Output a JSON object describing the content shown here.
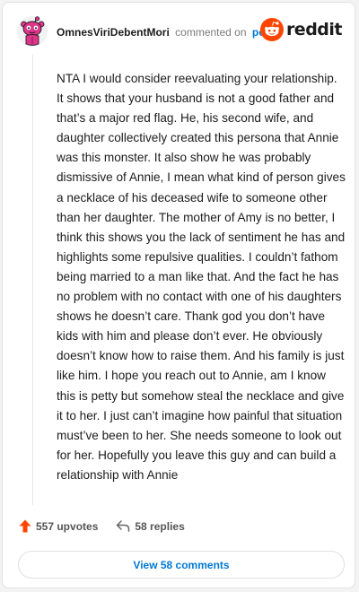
{
  "header": {
    "username": "OmnesViriDebentMori",
    "action_text": "commented on",
    "post_link": "post",
    "brand": "reddit"
  },
  "comment": {
    "text": "NTA I would consider reevaluating your relationship. It shows that your husband is not a good father and that’s a major red flag. He, his second wife, and daughter collectively created this persona that Annie was this monster. It also show he was probably dismissive of Annie, I mean what kind of person gives a necklace of his deceased wife to someone other than her daughter. The mother of Amy is no better, I think this shows you the lack of sentiment he has and highlights some repulsive qualities. I couldn’t fathom being married to a man like that. And the fact he has no problem with no contact with one of his daughters shows he doesn’t care. Thank god you don’t have kids with him and please don’t ever. He obviously doesn’t know how to raise them. And his family is just like him. I hope you reach out to Annie, am I know this is petty but somehow steal the necklace and give it to her. I just can’t imagine how painful that situation must’ve been to her. She needs someone to look out for her. Hopefully you leave this guy and can build a relationship with Annie"
  },
  "actions": {
    "upvotes": "557 upvotes",
    "replies": "58 replies",
    "view_comments": "View 58 comments"
  },
  "colors": {
    "reddit_orange": "#ff4500",
    "link_blue": "#0079d3",
    "avatar_pink": "#e0338c"
  },
  "icons": {
    "avatar": "snoo-avatar-icon",
    "brand": "reddit-logo-icon",
    "upvote": "upvote-arrow-icon",
    "reply": "reply-arrow-icon"
  }
}
